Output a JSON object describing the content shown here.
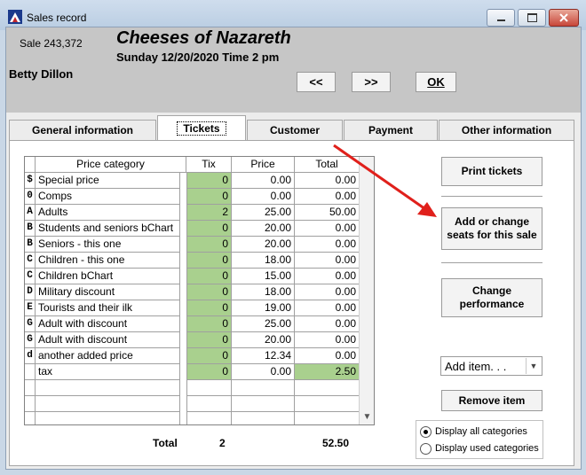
{
  "window": {
    "title": "Sales record",
    "controls": {
      "minimize": "–",
      "maximize": "▢",
      "close": "✕"
    }
  },
  "header": {
    "sale_number": "Sale 243,372",
    "customer_name": "Betty Dillon",
    "show_title": "Cheeses of Nazareth",
    "show_date": "Sunday 12/20/2020  Time 2 pm",
    "prev_label": "<<",
    "next_label": ">>",
    "ok_label": "OK"
  },
  "tabs": [
    {
      "label": "General information",
      "active": false
    },
    {
      "label": "Tickets",
      "active": true
    },
    {
      "label": "Customer",
      "active": false
    },
    {
      "label": "Payment",
      "active": false
    },
    {
      "label": "Other information",
      "active": false
    }
  ],
  "grid": {
    "columns": {
      "category": "Price category",
      "tix": "Tix",
      "price": "Price",
      "total": "Total"
    },
    "rows": [
      {
        "code": "$",
        "name": "Special price",
        "tix": "0",
        "price": "0.00",
        "total": "0.00"
      },
      {
        "code": "0",
        "name": "Comps",
        "tix": "0",
        "price": "0.00",
        "total": "0.00"
      },
      {
        "code": "A",
        "name": "Adults",
        "tix": "2",
        "price": "25.00",
        "total": "50.00"
      },
      {
        "code": "B",
        "name": "Students and seniors bChart",
        "tix": "0",
        "price": "20.00",
        "total": "0.00"
      },
      {
        "code": "B",
        "name": "Seniors - this one",
        "tix": "0",
        "price": "20.00",
        "total": "0.00"
      },
      {
        "code": "C",
        "name": "Children - this one",
        "tix": "0",
        "price": "18.00",
        "total": "0.00"
      },
      {
        "code": "C",
        "name": "Children bChart",
        "tix": "0",
        "price": "15.00",
        "total": "0.00"
      },
      {
        "code": "D",
        "name": "Military discount",
        "tix": "0",
        "price": "18.00",
        "total": "0.00"
      },
      {
        "code": "E",
        "name": "Tourists and their ilk",
        "tix": "0",
        "price": "19.00",
        "total": "0.00"
      },
      {
        "code": "G",
        "name": "Adult with discount",
        "tix": "0",
        "price": "25.00",
        "total": "0.00"
      },
      {
        "code": "G",
        "name": "Adult with discount",
        "tix": "0",
        "price": "20.00",
        "total": "0.00"
      },
      {
        "code": "d",
        "name": "another added price",
        "tix": "0",
        "price": "12.34",
        "total": "0.00"
      },
      {
        "code": "",
        "name": "tax",
        "tix": "0",
        "price": "0.00",
        "total": "2.50"
      }
    ],
    "empty_rows": 3,
    "totals": {
      "label": "Total",
      "tix": "2",
      "amount": "52.50"
    }
  },
  "actions": {
    "print_tickets": "Print tickets",
    "seats": "Add or change seats for this sale",
    "change_performance": "Change performance",
    "add_item": "Add item. . .",
    "remove_item": "Remove item"
  },
  "options": {
    "display_all": "Display all categories",
    "display_used": "Display used categories",
    "selected": "display_all"
  },
  "colors": {
    "cell_highlight": "#a9d08e",
    "annotation_arrow": "#e0201b"
  }
}
